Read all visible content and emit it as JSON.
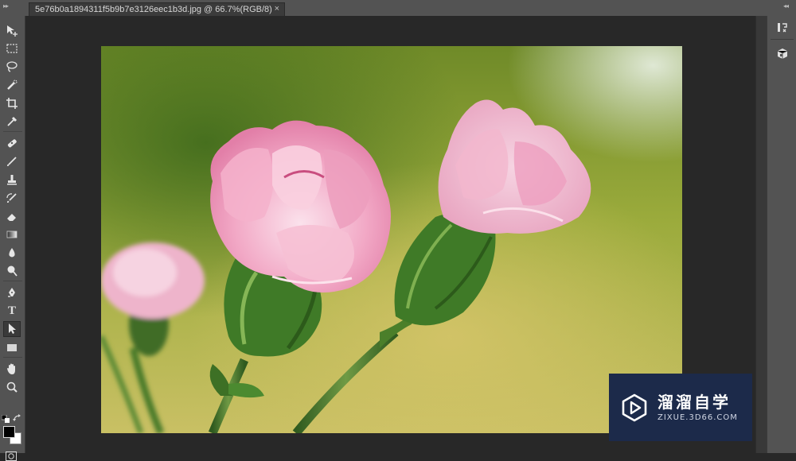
{
  "document": {
    "tab_title": "5e76b0a1894311f5b9b7e3126eec1b3d.jpg @ 66.7%(RGB/8)",
    "close_glyph": "×"
  },
  "tools": [
    {
      "id": "move",
      "icon": "move-icon"
    },
    {
      "id": "marquee",
      "icon": "rect-marquee-icon"
    },
    {
      "id": "lasso",
      "icon": "lasso-icon"
    },
    {
      "id": "quick-select",
      "icon": "quick-select-brush-icon"
    },
    {
      "id": "crop",
      "icon": "crop-icon"
    },
    {
      "id": "eyedropper",
      "icon": "eyedropper-icon"
    },
    {
      "id": "healing",
      "icon": "healing-brush-icon"
    },
    {
      "id": "brush",
      "icon": "brush-icon"
    },
    {
      "id": "stamp",
      "icon": "clone-stamp-icon"
    },
    {
      "id": "history-brush",
      "icon": "history-brush-icon"
    },
    {
      "id": "eraser",
      "icon": "eraser-icon"
    },
    {
      "id": "gradient",
      "icon": "gradient-icon"
    },
    {
      "id": "blur",
      "icon": "blur-drop-icon"
    },
    {
      "id": "dodge",
      "icon": "dodge-icon"
    },
    {
      "id": "pen",
      "icon": "pen-icon"
    },
    {
      "id": "type",
      "icon": "type-icon",
      "label": "T"
    },
    {
      "id": "path-select",
      "icon": "path-selection-arrow-icon",
      "active": true
    },
    {
      "id": "shape",
      "icon": "rectangle-shape-icon"
    },
    {
      "id": "hand",
      "icon": "hand-icon"
    },
    {
      "id": "zoom",
      "icon": "zoom-icon"
    }
  ],
  "colors": {
    "foreground": "#000000",
    "background": "#ffffff",
    "panel": "#535353",
    "canvas": "#282828"
  },
  "right_panel": [
    {
      "id": "history",
      "icon": "history-panel-icon"
    },
    {
      "id": "properties",
      "icon": "properties-3d-icon"
    }
  ],
  "watermark": {
    "name": "溜溜自学",
    "url": "ZIXUE.3D66.COM"
  }
}
